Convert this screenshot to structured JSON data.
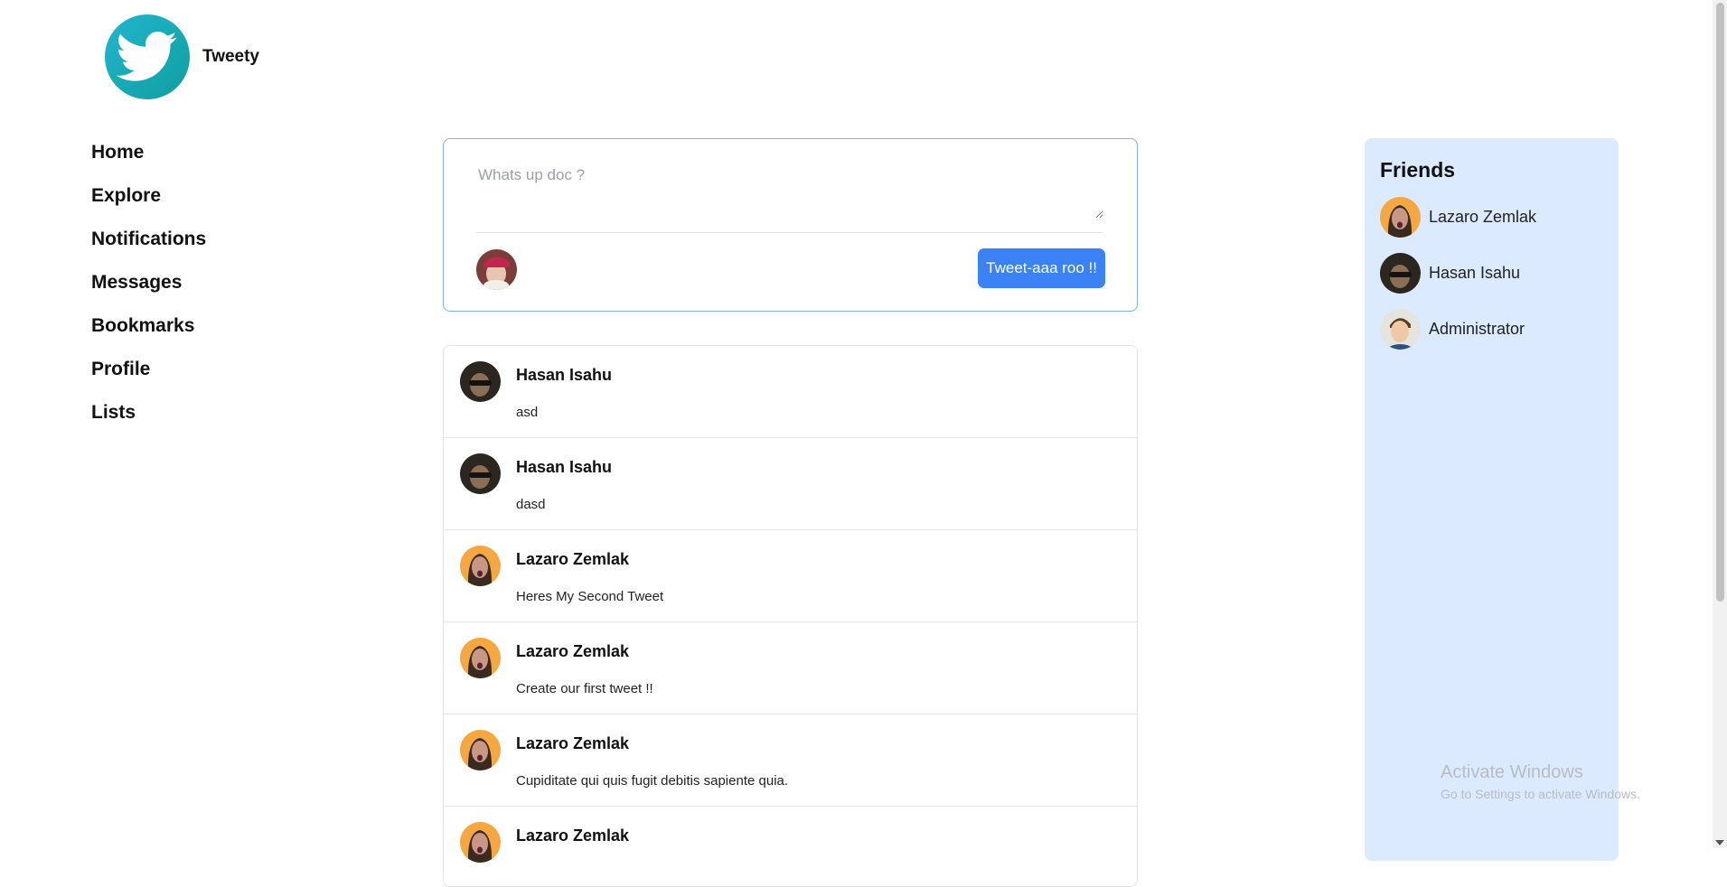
{
  "brand": {
    "name": "Tweety",
    "logo_icon": "bird-logo-icon",
    "logo_color": "#1aa8b8"
  },
  "nav": {
    "items": [
      {
        "label": "Home"
      },
      {
        "label": "Explore"
      },
      {
        "label": "Notifications"
      },
      {
        "label": "Messages"
      },
      {
        "label": "Bookmarks"
      },
      {
        "label": "Profile"
      },
      {
        "label": "Lists"
      }
    ]
  },
  "composer": {
    "placeholder": "Whats up doc ?",
    "value": "",
    "submit_label": "Tweet-aaa roo !!",
    "submit_color": "#3b82f6"
  },
  "feed": {
    "tweets": [
      {
        "author": "Hasan Isahu",
        "body": "asd"
      },
      {
        "author": "Hasan Isahu",
        "body": "dasd"
      },
      {
        "author": "Lazaro Zemlak",
        "body": "Heres My Second Tweet"
      },
      {
        "author": "Lazaro Zemlak",
        "body": "Create our first tweet !!"
      },
      {
        "author": "Lazaro Zemlak",
        "body": "Cupiditate qui quis fugit debitis sapiente quia."
      },
      {
        "author": "Lazaro Zemlak",
        "body": ""
      }
    ]
  },
  "friends": {
    "title": "Friends",
    "background": "#dbeafe",
    "items": [
      {
        "name": "Lazaro Zemlak"
      },
      {
        "name": "Hasan Isahu"
      },
      {
        "name": "Administrator"
      }
    ]
  },
  "watermark": {
    "line1": "Activate Windows",
    "line2": "Go to Settings to activate Windows."
  }
}
